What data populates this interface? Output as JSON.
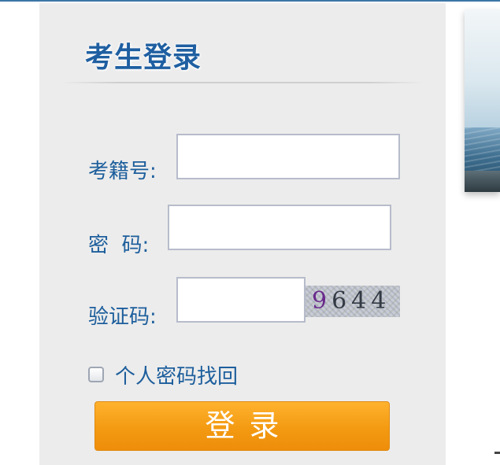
{
  "login": {
    "title": "考生登录",
    "exam_id_label": "考籍号:",
    "password_label": "密  码:",
    "captcha_label": "验证码:",
    "exam_id_value": "",
    "password_value": "",
    "captcha_value": "",
    "captcha_code_first": "9",
    "captcha_code_rest": "644",
    "remember_label": "个人密码找回",
    "remember_checked": false,
    "submit_label": "登录"
  },
  "colors": {
    "label_text": "#1d5e9c",
    "panel_bg": "#ececec",
    "button_orange": "#f39a12",
    "title_blue": "#1f5fa1"
  },
  "icons": {
    "checkbox": "checkbox-unchecked"
  }
}
